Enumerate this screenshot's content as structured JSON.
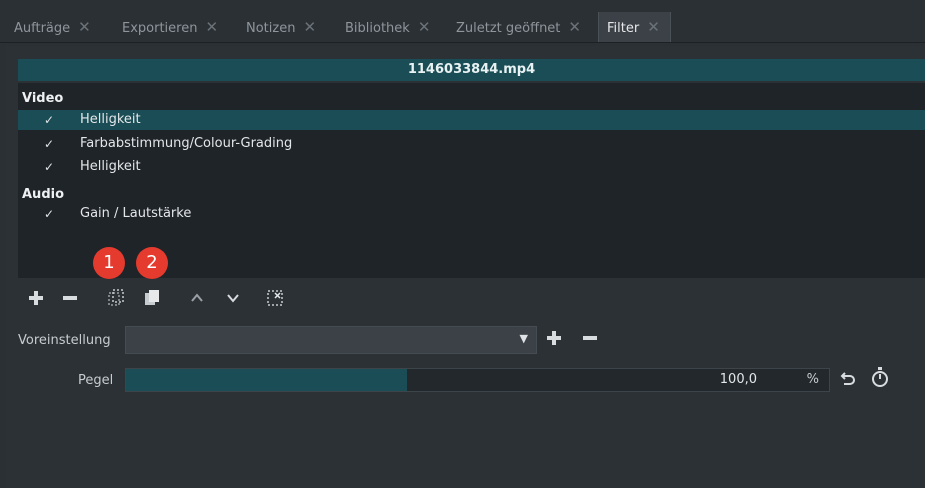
{
  "tabs": [
    {
      "label": "Aufträge",
      "close": "✕"
    },
    {
      "label": "Exportieren",
      "close": "✕"
    },
    {
      "label": "Notizen",
      "close": "✕"
    },
    {
      "label": "Bibliothek",
      "close": "✕"
    },
    {
      "label": "Zuletzt geöffnet",
      "close": "✕"
    },
    {
      "label": "Filter",
      "close": "✕",
      "active": true
    }
  ],
  "clip": {
    "filename": "1146033844.mp4"
  },
  "filters": {
    "video_header": "Video",
    "audio_header": "Audio",
    "video": [
      {
        "check": "✓",
        "label": "Helligkeit",
        "selected": true
      },
      {
        "check": "✓",
        "label": "Farbabstimmung/Colour-Grading"
      },
      {
        "check": "✓",
        "label": "Helligkeit"
      }
    ],
    "audio": [
      {
        "check": "✓",
        "label": "Gain / Lautstärke"
      }
    ]
  },
  "badges": {
    "one": "1",
    "two": "2"
  },
  "toolbar": {
    "icons": [
      "add-icon",
      "remove-icon",
      "copy-icon",
      "paste-icon",
      "move-up-icon",
      "move-down-icon",
      "deselect-icon"
    ]
  },
  "preset": {
    "label": "Voreinstellung",
    "value": ""
  },
  "pegel": {
    "label": "Pegel",
    "value": "100,0",
    "unit": "%",
    "fill_percent": 40
  },
  "colors": {
    "accent": "#1a4d55",
    "badge": "#e53b2e"
  }
}
